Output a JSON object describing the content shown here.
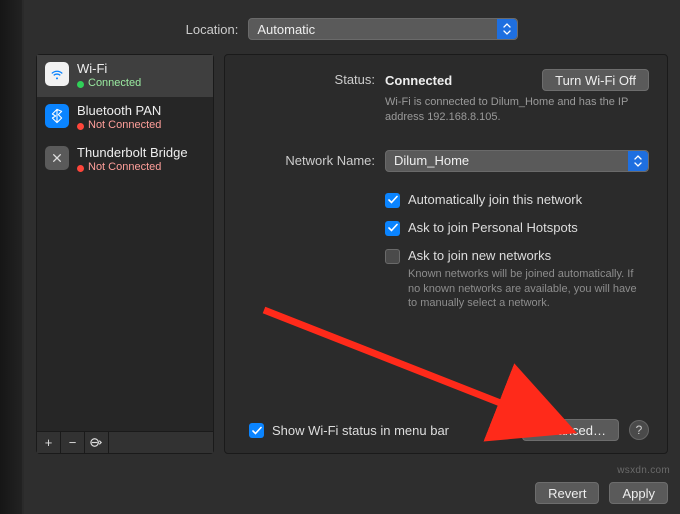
{
  "location": {
    "label": "Location:",
    "value": "Automatic"
  },
  "sidebar": {
    "items": [
      {
        "name": "Wi-Fi",
        "status": "Connected",
        "connected": true,
        "icon": "wifi"
      },
      {
        "name": "Bluetooth PAN",
        "status": "Not Connected",
        "connected": false,
        "icon": "bluetooth"
      },
      {
        "name": "Thunderbolt Bridge",
        "status": "Not Connected",
        "connected": false,
        "icon": "thunderbolt"
      }
    ],
    "footer": {
      "add": "+",
      "remove": "−",
      "options": "⊖"
    }
  },
  "main": {
    "status_label": "Status:",
    "status_value": "Connected",
    "turn_off_label": "Turn Wi-Fi Off",
    "status_desc": "Wi-Fi is connected to Dilum_Home and has the IP address 192.168.8.105.",
    "network_name_label": "Network Name:",
    "network_name_value": "Dilum_Home",
    "auto_join_label": "Automatically join this network",
    "ask_hotspot_label": "Ask to join Personal Hotspots",
    "ask_new_label": "Ask to join new networks",
    "ask_new_desc": "Known networks will be joined automatically. If no known networks are available, you will have to manually select a network.",
    "show_status_label": "Show Wi-Fi status in menu bar",
    "advanced_label": "Advanced…",
    "help": "?"
  },
  "buttons": {
    "revert": "Revert",
    "apply": "Apply"
  },
  "watermark": "wsxdn.com"
}
